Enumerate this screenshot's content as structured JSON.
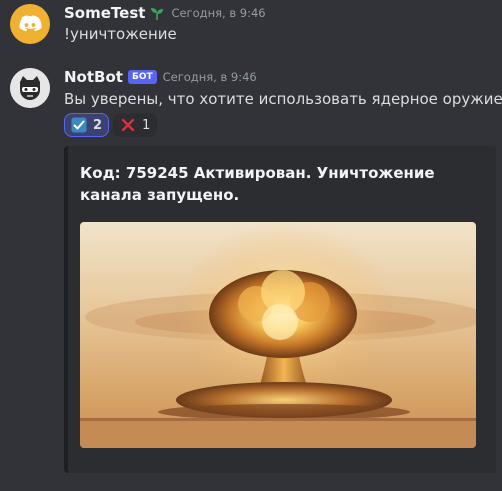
{
  "messages": [
    {
      "username": "SomeTest",
      "timestamp": "Сегодня, в 9:46",
      "text": "!уничтожение",
      "username_color": "#f2f3f5",
      "avatar_color": "#f0b132",
      "avatar_icon": "discord-logo-icon",
      "badge_icon": "sprout-icon"
    },
    {
      "username": "NotBot",
      "bot_tag": "БОТ",
      "timestamp": "Сегодня, в 9:46",
      "text": "Вы уверены, что хотите использовать ядерное оружие?",
      "avatar_icon": "cat-face-icon",
      "reactions": [
        {
          "emoji": "check-box-icon",
          "count": "2",
          "reacted_by_me": true
        },
        {
          "emoji": "cross-mark-icon",
          "count": "1",
          "reacted_by_me": false
        }
      ],
      "embed": {
        "title": "Код: 759245 Активирован. Уничтожение канала запущено.",
        "image": "nuclear-mushroom-cloud-image"
      }
    }
  ],
  "colors": {
    "background": "#313338",
    "embed_background": "#2b2d31",
    "bot_tag": "#5865f2",
    "reaction_selected": "#3c4270"
  }
}
